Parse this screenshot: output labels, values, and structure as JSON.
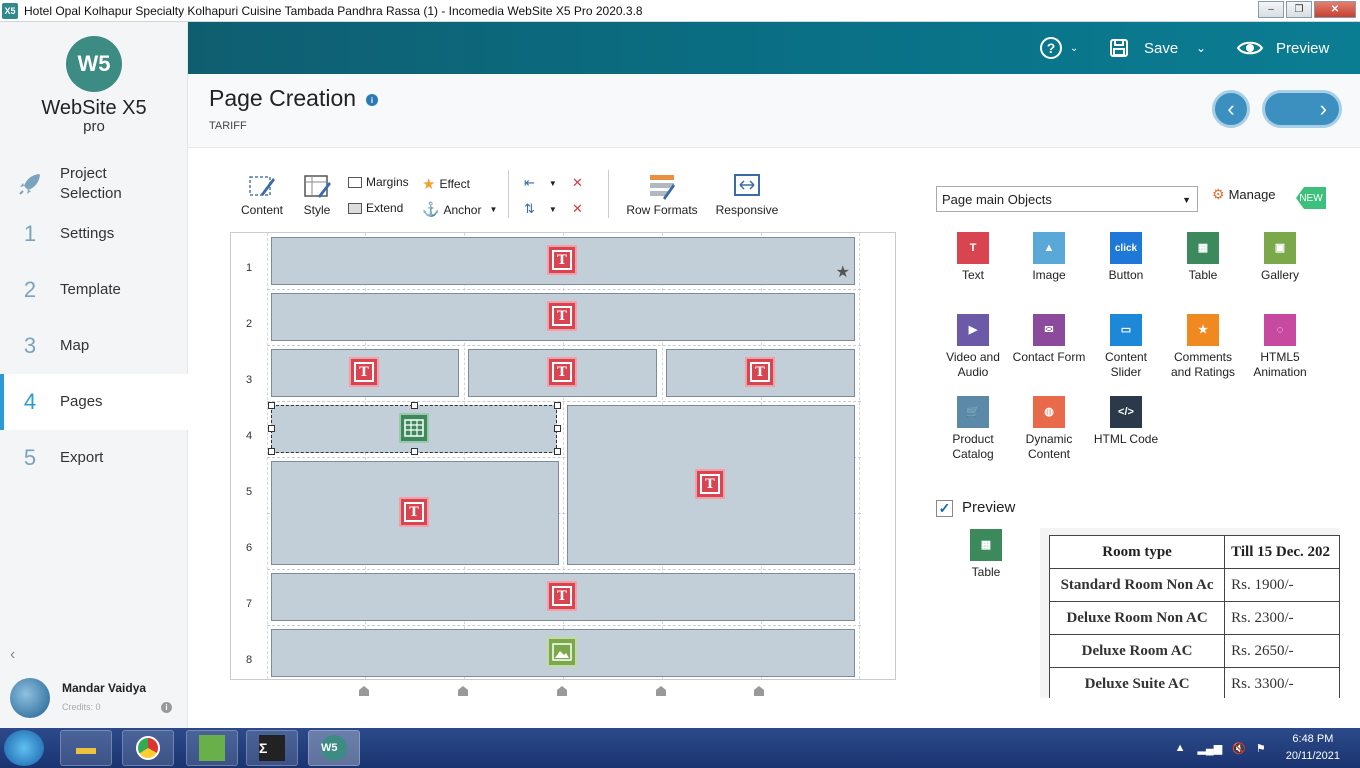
{
  "window": {
    "title": "Hotel Opal Kolhapur Specialty Kolhapuri Cuisine Tambada Pandhra Rassa (1) - Incomedia WebSite X5 Pro 2020.3.8",
    "app_icon": "X5"
  },
  "logo": {
    "mark": "W5",
    "name": "WebSite X5",
    "edition": "pro"
  },
  "nav": {
    "items": [
      {
        "num": "",
        "label": "Project Selection",
        "icon": "rocket-icon"
      },
      {
        "num": "1",
        "label": "Settings"
      },
      {
        "num": "2",
        "label": "Template"
      },
      {
        "num": "3",
        "label": "Map"
      },
      {
        "num": "4",
        "label": "Pages",
        "active": true
      },
      {
        "num": "5",
        "label": "Export"
      }
    ]
  },
  "user": {
    "name": "Mandar Vaidya",
    "credits": "Credits: 0"
  },
  "topbar": {
    "help": "?",
    "save": "Save",
    "preview": "Preview"
  },
  "header": {
    "title": "Page Creation",
    "subtitle": "TARIFF"
  },
  "toolbar": {
    "content": "Content",
    "style": "Style",
    "margins": "Margins",
    "effect": "Effect",
    "extend": "Extend",
    "anchor": "Anchor",
    "row_formats": "Row Formats",
    "responsive": "Responsive"
  },
  "grid": {
    "rows": [
      "1",
      "2",
      "3",
      "4",
      "5",
      "6",
      "7",
      "8"
    ]
  },
  "objects_panel": {
    "dropdown": "Page main Objects",
    "manage": "Manage",
    "new_badge": "NEW",
    "items": [
      {
        "label": "Text",
        "color": "#d84450"
      },
      {
        "label": "Image",
        "color": "#5aa8d8"
      },
      {
        "label": "Button",
        "color": "#1e78d8",
        "glyph": "click"
      },
      {
        "label": "Table",
        "color": "#3c8a5c"
      },
      {
        "label": "Gallery",
        "color": "#7aa84a"
      },
      {
        "label": "Video and Audio",
        "color": "#6c5aa8"
      },
      {
        "label": "Contact Form",
        "color": "#8c4a9c"
      },
      {
        "label": "Content Slider",
        "color": "#1e88d8"
      },
      {
        "label": "Comments and Ratings",
        "color": "#f08a20"
      },
      {
        "label": "HTML5 Animation",
        "color": "#c84aa0"
      },
      {
        "label": "Product Catalog",
        "color": "#5a8aa8"
      },
      {
        "label": "Dynamic Content",
        "color": "#e86a4a"
      },
      {
        "label": "HTML Code",
        "color": "#2a3a4a"
      }
    ]
  },
  "preview": {
    "label": "Preview",
    "object_label": "Table",
    "table": {
      "headers": [
        "Room type",
        "Till 15 Dec. 202"
      ],
      "rows": [
        [
          "Standard Room Non Ac",
          "Rs. 1900/-"
        ],
        [
          "Deluxe Room Non AC",
          "Rs. 2300/-"
        ],
        [
          "Deluxe Room AC",
          "Rs. 2650/-"
        ],
        [
          "Deluxe Suite AC",
          "Rs. 3300/-"
        ]
      ]
    }
  },
  "taskbar": {
    "time": "6:48 PM",
    "date": "20/11/2021"
  }
}
